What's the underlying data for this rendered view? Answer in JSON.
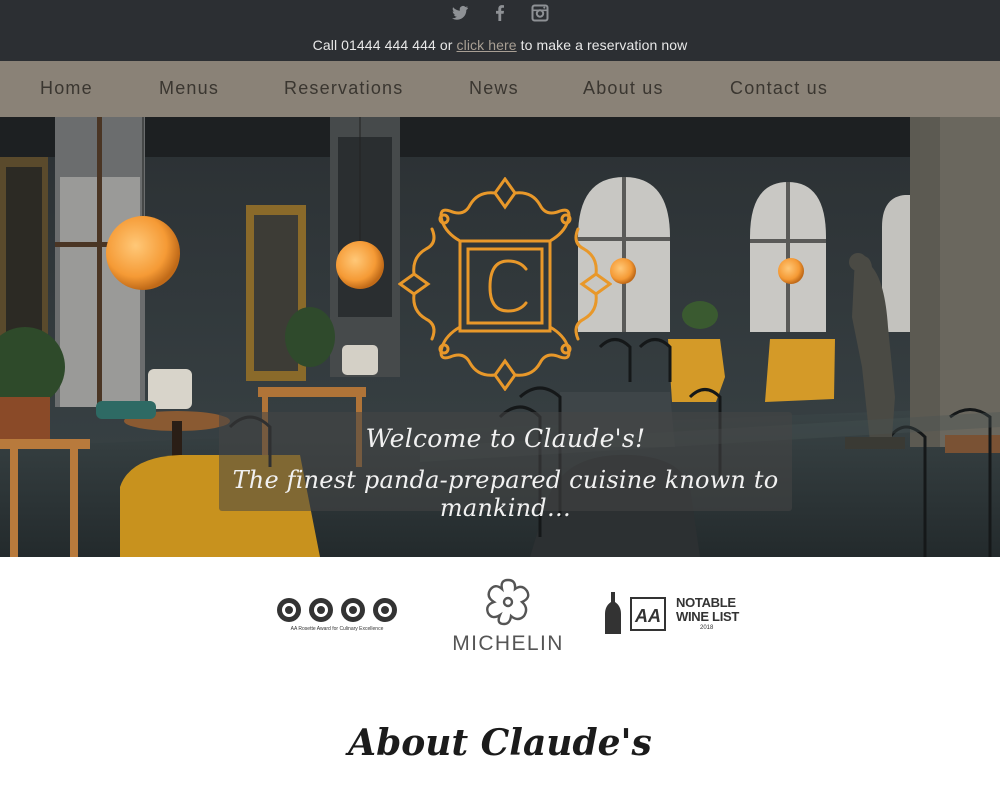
{
  "social": {
    "icons": [
      "twitter-icon",
      "facebook-icon",
      "instagram-icon"
    ]
  },
  "callbar": {
    "prefix": "Call 01444 444 444 or ",
    "link": "click here",
    "suffix": " to make a reservation now"
  },
  "nav": {
    "items": [
      "Home",
      "Menus",
      "Reservations",
      "News",
      "About us",
      "Contact us"
    ]
  },
  "crest": {
    "letter": "C"
  },
  "hero": {
    "line1": "Welcome to Claude's!",
    "line2": "The finest panda-prepared cuisine known to mankind…"
  },
  "awards": {
    "rosette_caption": "AA Rosette Award for Culinary Excellence",
    "michelin": "MICHELIN",
    "wine_badge": "AA",
    "wine_line1": "NOTABLE",
    "wine_line2": "WINE LIST",
    "wine_year": "2018"
  },
  "about": {
    "title": "About Claude's"
  },
  "colors": {
    "topbar": "#2c2f33",
    "nav": "#8a8277",
    "crest": "#e8982a"
  }
}
